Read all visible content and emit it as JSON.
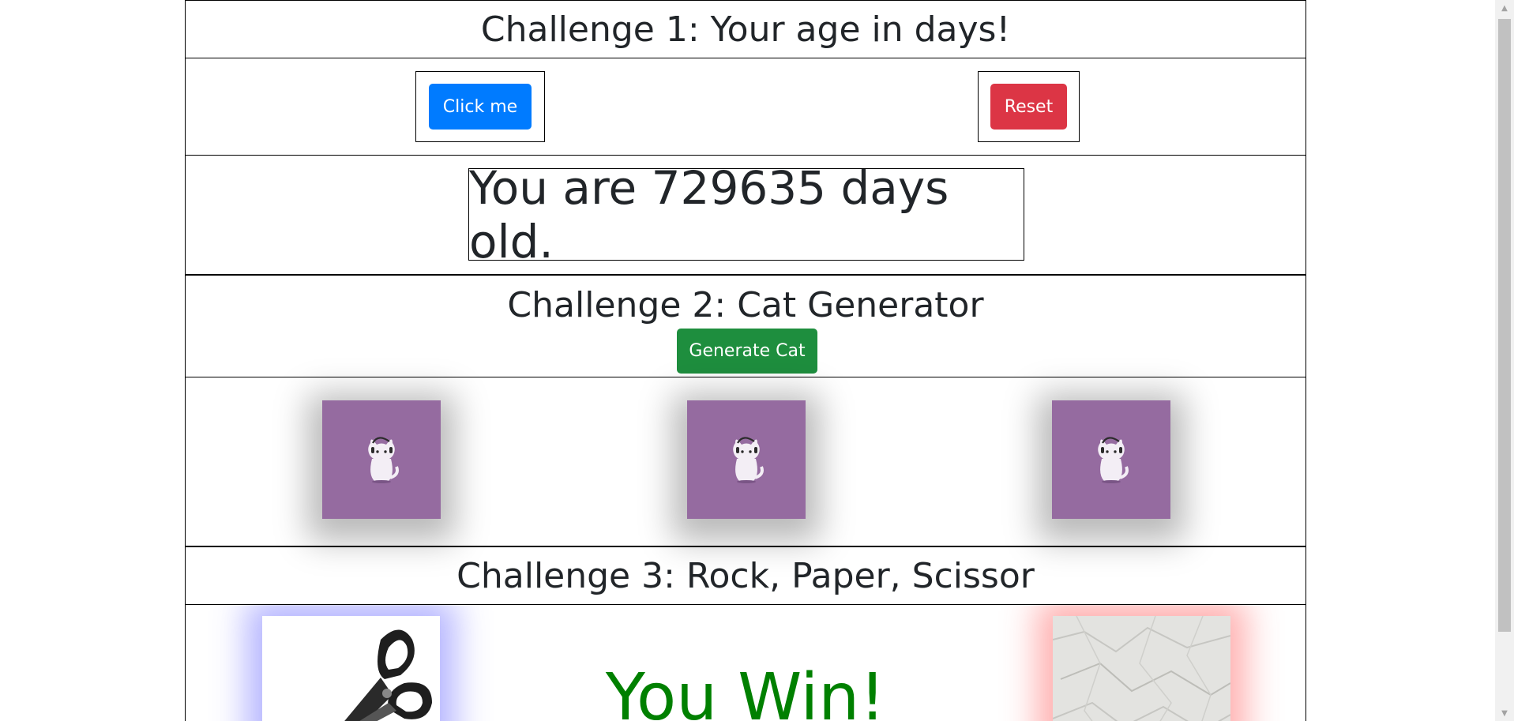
{
  "challenge1": {
    "title": "Challenge 1: Your age in days!",
    "click_label": "Click me",
    "reset_label": "Reset",
    "result_text": "You are 729635 days old."
  },
  "challenge2": {
    "title": "Challenge 2: Cat Generator",
    "generate_label": "Generate Cat",
    "cat_color": "#956ba0"
  },
  "challenge3": {
    "title": "Challenge 3: Rock, Paper, Scissor",
    "human_choice": "scissors-image",
    "bot_choice": "paper-image",
    "result_text": "You Win!",
    "result_color": "#008000"
  },
  "colors": {
    "primary": "#007bff",
    "danger": "#dc3545",
    "success": "#1e8e3e"
  }
}
